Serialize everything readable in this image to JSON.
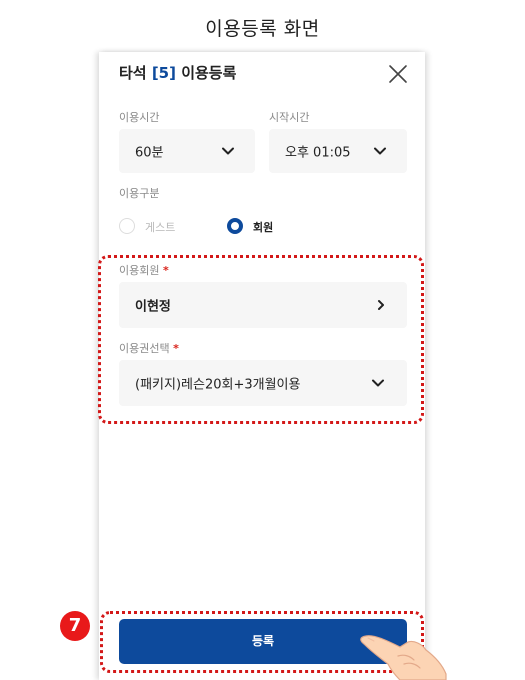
{
  "caption": "이용등록 화면",
  "modal": {
    "title_prefix": "타석 ",
    "title_number": "[5]",
    "title_suffix": " 이용등록"
  },
  "usage_time": {
    "label": "이용시간",
    "value": "60분"
  },
  "start_time": {
    "label": "시작시간",
    "value": "오후 01:05"
  },
  "usage_type": {
    "label": "이용구분",
    "options": [
      "게스트",
      "회원"
    ],
    "selected": "회원"
  },
  "member": {
    "label": "이용회원",
    "required_mark": "*",
    "value": "이현정"
  },
  "pass": {
    "label": "이용권선택",
    "required_mark": "*",
    "value": "(패키지)레슨20회+3개월이용"
  },
  "submit_label": "등록",
  "step_number": "7",
  "colors": {
    "accent": "#0d4a9c",
    "highlight": "#d31818",
    "required": "#d9241c",
    "badge": "#e8191a"
  }
}
